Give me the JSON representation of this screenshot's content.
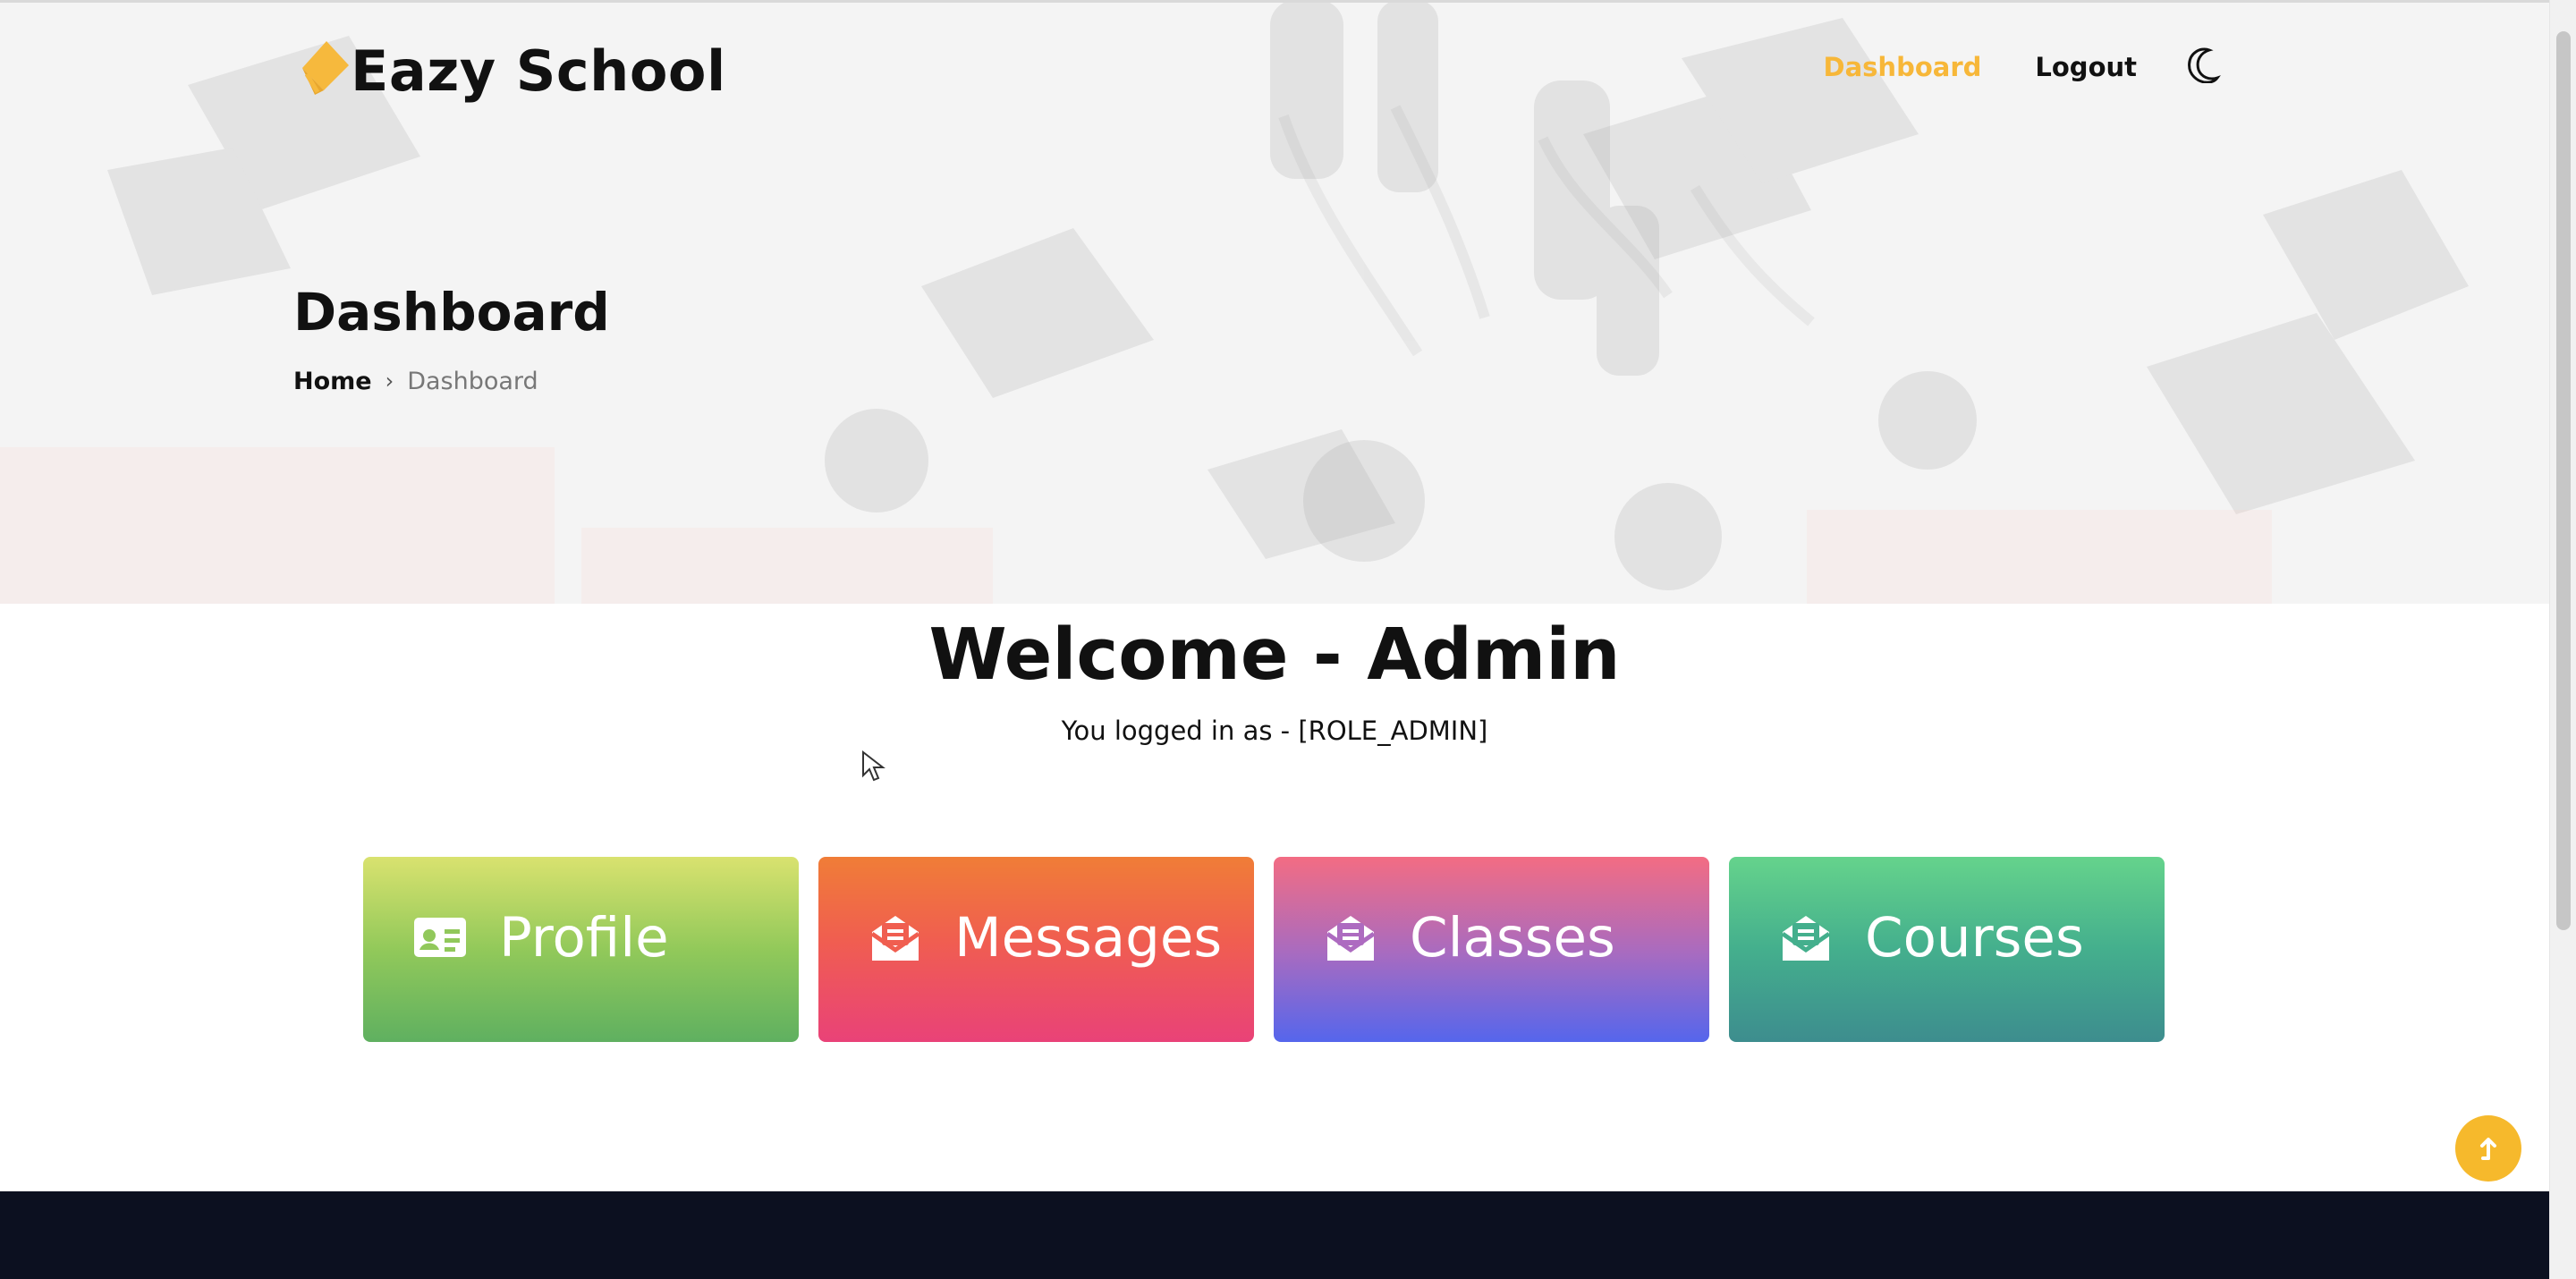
{
  "header": {
    "brand": "Eazy School",
    "nav": {
      "dashboard": "Dashboard",
      "logout": "Logout"
    },
    "theme_icon": "moon-icon"
  },
  "hero": {
    "title": "Dashboard",
    "breadcrumb": {
      "home": "Home",
      "separator": "›",
      "current": "Dashboard"
    }
  },
  "main": {
    "welcome": "Welcome - Admin",
    "role": "You logged in as - [ROLE_ADMIN]",
    "tiles": [
      {
        "label": "Profile",
        "icon": "id-card-icon"
      },
      {
        "label": "Messages",
        "icon": "envelope-open-icon"
      },
      {
        "label": "Classes",
        "icon": "envelope-open-icon"
      },
      {
        "label": "Courses",
        "icon": "envelope-open-icon"
      }
    ]
  },
  "controls": {
    "back_to_top_icon": "arrow-up-icon"
  },
  "colors": {
    "accent": "#f7b739",
    "footer": "#0c1020",
    "profile_top": "#d9e26f",
    "profile_bottom": "#5fb060",
    "messages_top": "#f07d37",
    "messages_bottom": "#e94278",
    "classes_top": "#f36c83",
    "classes_bottom": "#5566ec",
    "courses_top": "#65d38c",
    "courses_bottom": "#3d8d8e"
  }
}
